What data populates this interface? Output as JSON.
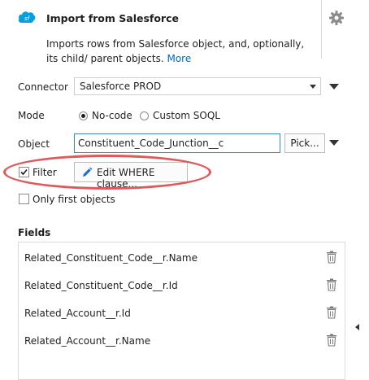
{
  "header": {
    "title": "Import from Salesforce",
    "logo_text": "sf",
    "description": "Imports rows from Salesforce object, and, optionally, its child/ parent objects.",
    "more_link": "More"
  },
  "connector": {
    "label": "Connector",
    "value": "Salesforce PROD"
  },
  "mode": {
    "label": "Mode",
    "options": [
      {
        "label": "No-code",
        "selected": true
      },
      {
        "label": "Custom SOQL",
        "selected": false
      }
    ]
  },
  "object": {
    "label": "Object",
    "value": "Constituent_Code_Junction__c",
    "pick_label": "Pick..."
  },
  "filter": {
    "label": "Filter",
    "checked": true,
    "edit_where_label": "Edit WHERE clause..."
  },
  "only_first": {
    "label": "Only first objects",
    "checked": false
  },
  "fields": {
    "heading": "Fields",
    "items": [
      "Related_Constituent_Code__r.Name",
      "Related_Constituent_Code__r.Id",
      "Related_Account__r.Id",
      "Related_Account__r.Name"
    ]
  },
  "colors": {
    "accent": "#0066cc",
    "highlight_oval": "#dd5a5a",
    "input_focus_border": "#3c84d6",
    "salesforce_blue": "#00a1e0"
  }
}
